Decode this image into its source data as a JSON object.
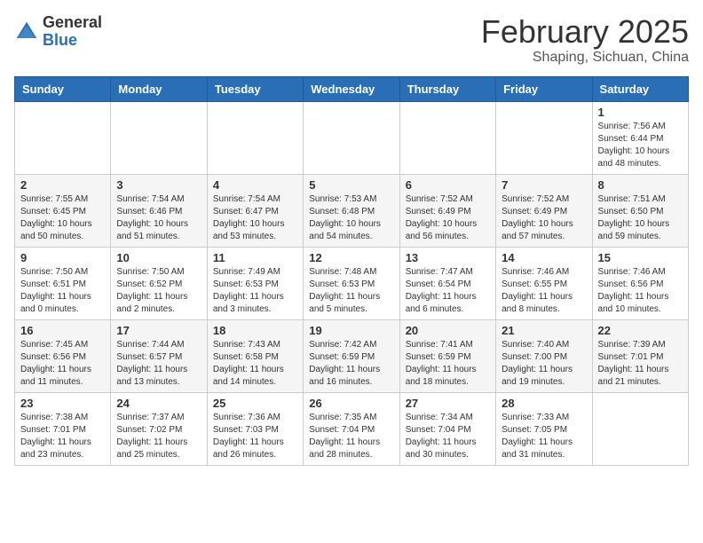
{
  "header": {
    "logo_general": "General",
    "logo_blue": "Blue",
    "month_title": "February 2025",
    "location": "Shaping, Sichuan, China"
  },
  "weekdays": [
    "Sunday",
    "Monday",
    "Tuesday",
    "Wednesday",
    "Thursday",
    "Friday",
    "Saturday"
  ],
  "weeks": [
    [
      {
        "day": "",
        "info": ""
      },
      {
        "day": "",
        "info": ""
      },
      {
        "day": "",
        "info": ""
      },
      {
        "day": "",
        "info": ""
      },
      {
        "day": "",
        "info": ""
      },
      {
        "day": "",
        "info": ""
      },
      {
        "day": "1",
        "info": "Sunrise: 7:56 AM\nSunset: 6:44 PM\nDaylight: 10 hours and 48 minutes."
      }
    ],
    [
      {
        "day": "2",
        "info": "Sunrise: 7:55 AM\nSunset: 6:45 PM\nDaylight: 10 hours and 50 minutes."
      },
      {
        "day": "3",
        "info": "Sunrise: 7:54 AM\nSunset: 6:46 PM\nDaylight: 10 hours and 51 minutes."
      },
      {
        "day": "4",
        "info": "Sunrise: 7:54 AM\nSunset: 6:47 PM\nDaylight: 10 hours and 53 minutes."
      },
      {
        "day": "5",
        "info": "Sunrise: 7:53 AM\nSunset: 6:48 PM\nDaylight: 10 hours and 54 minutes."
      },
      {
        "day": "6",
        "info": "Sunrise: 7:52 AM\nSunset: 6:49 PM\nDaylight: 10 hours and 56 minutes."
      },
      {
        "day": "7",
        "info": "Sunrise: 7:52 AM\nSunset: 6:49 PM\nDaylight: 10 hours and 57 minutes."
      },
      {
        "day": "8",
        "info": "Sunrise: 7:51 AM\nSunset: 6:50 PM\nDaylight: 10 hours and 59 minutes."
      }
    ],
    [
      {
        "day": "9",
        "info": "Sunrise: 7:50 AM\nSunset: 6:51 PM\nDaylight: 11 hours and 0 minutes."
      },
      {
        "day": "10",
        "info": "Sunrise: 7:50 AM\nSunset: 6:52 PM\nDaylight: 11 hours and 2 minutes."
      },
      {
        "day": "11",
        "info": "Sunrise: 7:49 AM\nSunset: 6:53 PM\nDaylight: 11 hours and 3 minutes."
      },
      {
        "day": "12",
        "info": "Sunrise: 7:48 AM\nSunset: 6:53 PM\nDaylight: 11 hours and 5 minutes."
      },
      {
        "day": "13",
        "info": "Sunrise: 7:47 AM\nSunset: 6:54 PM\nDaylight: 11 hours and 6 minutes."
      },
      {
        "day": "14",
        "info": "Sunrise: 7:46 AM\nSunset: 6:55 PM\nDaylight: 11 hours and 8 minutes."
      },
      {
        "day": "15",
        "info": "Sunrise: 7:46 AM\nSunset: 6:56 PM\nDaylight: 11 hours and 10 minutes."
      }
    ],
    [
      {
        "day": "16",
        "info": "Sunrise: 7:45 AM\nSunset: 6:56 PM\nDaylight: 11 hours and 11 minutes."
      },
      {
        "day": "17",
        "info": "Sunrise: 7:44 AM\nSunset: 6:57 PM\nDaylight: 11 hours and 13 minutes."
      },
      {
        "day": "18",
        "info": "Sunrise: 7:43 AM\nSunset: 6:58 PM\nDaylight: 11 hours and 14 minutes."
      },
      {
        "day": "19",
        "info": "Sunrise: 7:42 AM\nSunset: 6:59 PM\nDaylight: 11 hours and 16 minutes."
      },
      {
        "day": "20",
        "info": "Sunrise: 7:41 AM\nSunset: 6:59 PM\nDaylight: 11 hours and 18 minutes."
      },
      {
        "day": "21",
        "info": "Sunrise: 7:40 AM\nSunset: 7:00 PM\nDaylight: 11 hours and 19 minutes."
      },
      {
        "day": "22",
        "info": "Sunrise: 7:39 AM\nSunset: 7:01 PM\nDaylight: 11 hours and 21 minutes."
      }
    ],
    [
      {
        "day": "23",
        "info": "Sunrise: 7:38 AM\nSunset: 7:01 PM\nDaylight: 11 hours and 23 minutes."
      },
      {
        "day": "24",
        "info": "Sunrise: 7:37 AM\nSunset: 7:02 PM\nDaylight: 11 hours and 25 minutes."
      },
      {
        "day": "25",
        "info": "Sunrise: 7:36 AM\nSunset: 7:03 PM\nDaylight: 11 hours and 26 minutes."
      },
      {
        "day": "26",
        "info": "Sunrise: 7:35 AM\nSunset: 7:04 PM\nDaylight: 11 hours and 28 minutes."
      },
      {
        "day": "27",
        "info": "Sunrise: 7:34 AM\nSunset: 7:04 PM\nDaylight: 11 hours and 30 minutes."
      },
      {
        "day": "28",
        "info": "Sunrise: 7:33 AM\nSunset: 7:05 PM\nDaylight: 11 hours and 31 minutes."
      },
      {
        "day": "",
        "info": ""
      }
    ]
  ]
}
